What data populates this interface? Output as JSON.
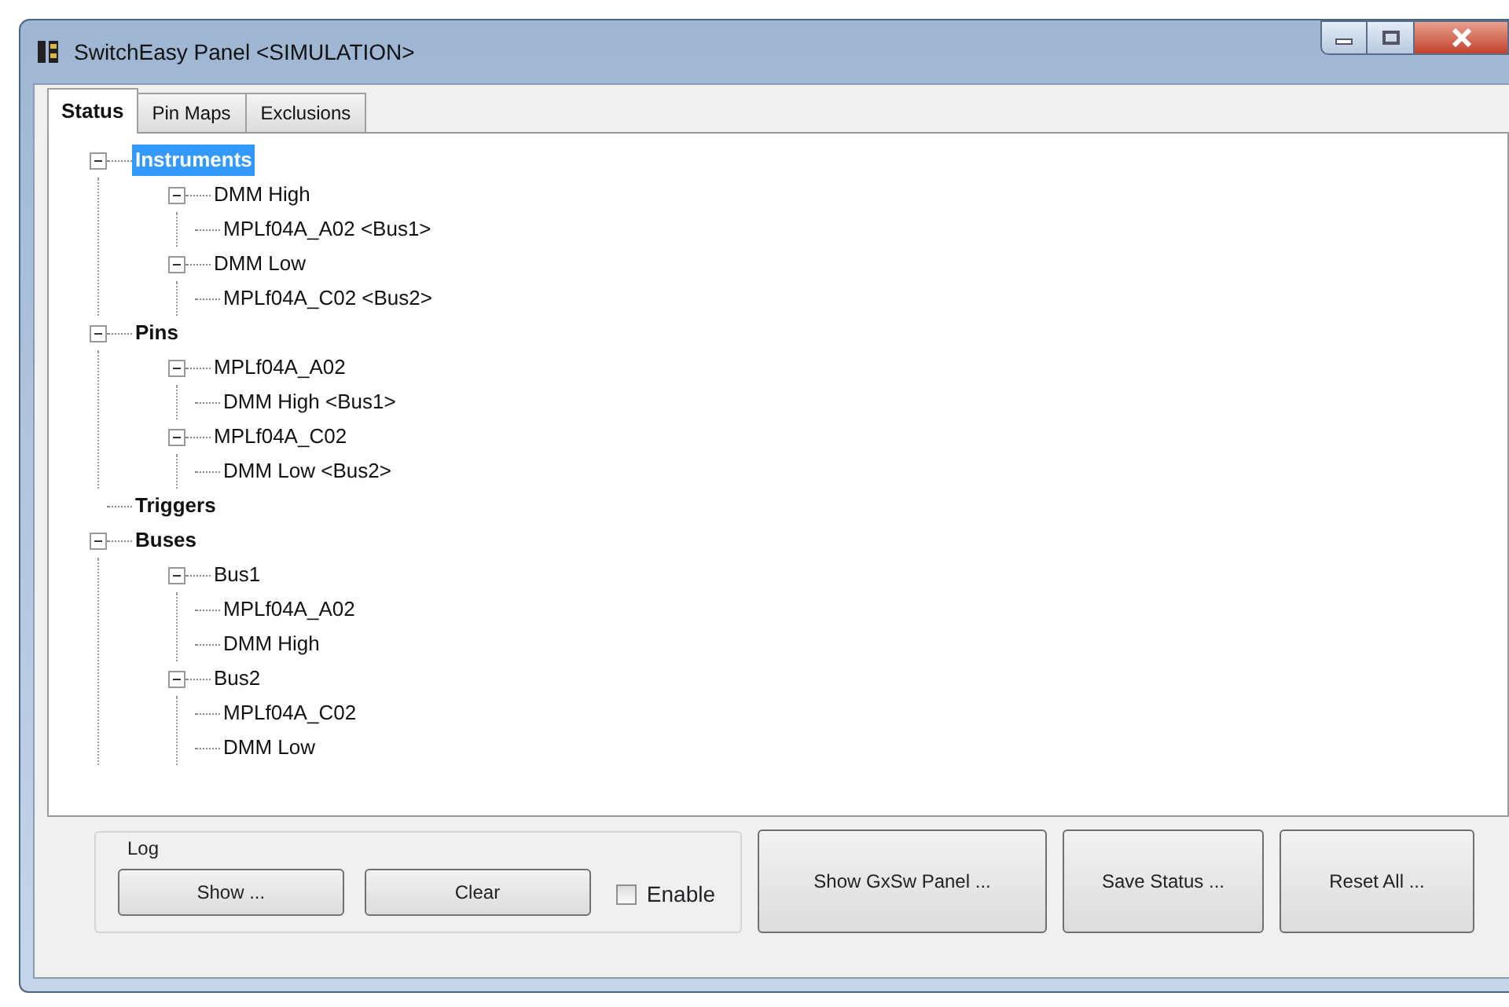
{
  "window": {
    "title": "SwitchEasy Panel <SIMULATION>"
  },
  "tabs": [
    {
      "label": "Status",
      "selected": true
    },
    {
      "label": "Pin Maps",
      "selected": false
    },
    {
      "label": "Exclusions",
      "selected": false
    }
  ],
  "tree": [
    {
      "label": "Instruments",
      "expanded": true,
      "selected": true,
      "children": [
        {
          "label": "DMM High",
          "expanded": true,
          "selected": false,
          "children": [
            {
              "label": "MPLf04A_A02 <Bus1>",
              "selected": false
            }
          ]
        },
        {
          "label": "DMM Low",
          "expanded": true,
          "selected": false,
          "children": [
            {
              "label": "MPLf04A_C02 <Bus2>",
              "selected": false
            }
          ]
        }
      ]
    },
    {
      "label": "Pins",
      "expanded": true,
      "selected": false,
      "children": [
        {
          "label": "MPLf04A_A02",
          "expanded": true,
          "selected": false,
          "children": [
            {
              "label": "DMM High <Bus1>",
              "selected": false
            }
          ]
        },
        {
          "label": "MPLf04A_C02",
          "expanded": true,
          "selected": false,
          "children": [
            {
              "label": "DMM Low <Bus2>",
              "selected": false
            }
          ]
        }
      ]
    },
    {
      "label": "Triggers",
      "selected": false
    },
    {
      "label": "Buses",
      "expanded": true,
      "selected": false,
      "children": [
        {
          "label": "Bus1",
          "expanded": true,
          "selected": false,
          "children": [
            {
              "label": "MPLf04A_A02",
              "selected": false
            },
            {
              "label": "DMM High",
              "selected": false
            }
          ]
        },
        {
          "label": "Bus2",
          "expanded": true,
          "selected": false,
          "children": [
            {
              "label": "MPLf04A_C02",
              "selected": false
            },
            {
              "label": "DMM Low",
              "selected": false
            }
          ]
        }
      ]
    }
  ],
  "log": {
    "title": "Log",
    "buttons": [
      "Show ...",
      "Clear"
    ],
    "enable": {
      "label": "Enable",
      "checked": false
    }
  },
  "buttons": [
    "Show GxSw Panel ...",
    "Save Status ...",
    "Reset All ..."
  ]
}
